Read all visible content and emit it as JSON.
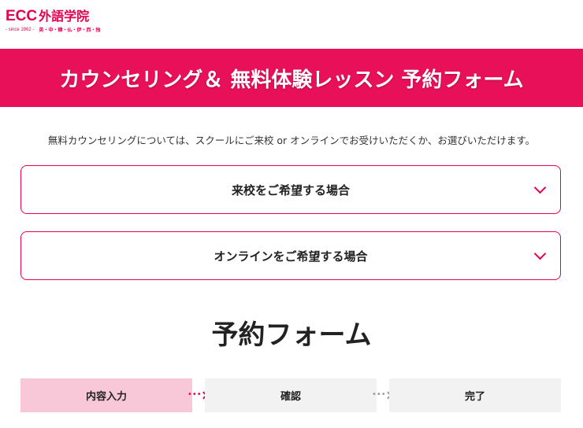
{
  "logo": {
    "brand": "ECC",
    "name_jp": "外語学院",
    "since": "- since 1962 -",
    "languages": "英・中・韓・仏・伊・西・独"
  },
  "banner": {
    "title": "カウンセリング＆ 無料体験レッスン 予約フォーム"
  },
  "intro": {
    "text": "無料カウンセリングについては、スクールにご来校 or オンラインでお受けいただくか、お選びいただけます。"
  },
  "options": [
    {
      "label": "来校をご希望する場合"
    },
    {
      "label": "オンラインをご希望する場合"
    }
  ],
  "form": {
    "title": "予約フォーム",
    "steps": [
      {
        "label": "内容入力",
        "state": "active"
      },
      {
        "label": "確認",
        "state": "inactive"
      },
      {
        "label": "完了",
        "state": "inactive"
      }
    ]
  },
  "colors": {
    "brand": "#e5004f",
    "banner": "#e9105a",
    "step_active": "#f8c8d8",
    "step_inactive": "#f2f2f2"
  },
  "icons": {
    "accordion": "chevron-down-icon",
    "step_separator": "dotted-arrow-right-icon"
  }
}
